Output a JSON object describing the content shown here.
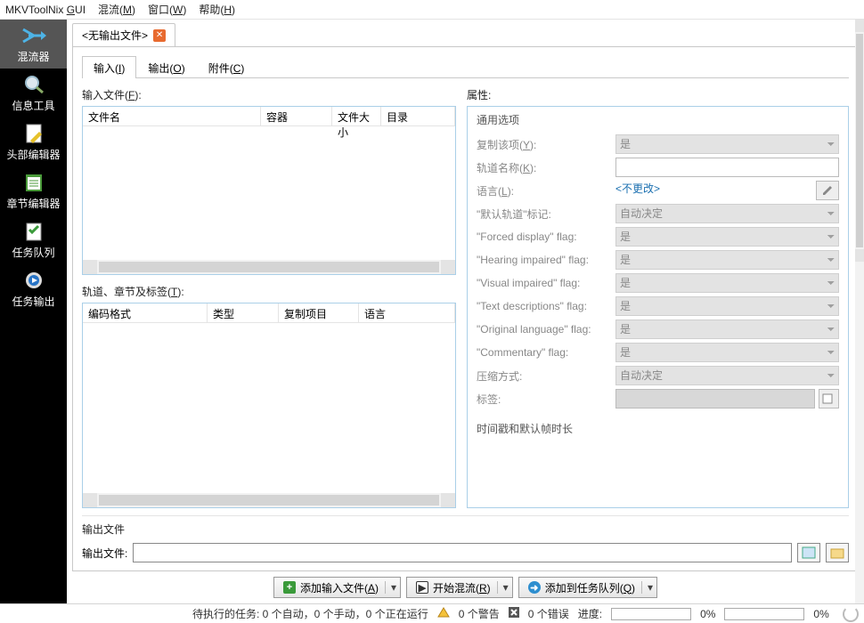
{
  "menu": {
    "app": "MKVToolNix GUI",
    "mux": "混流(M)",
    "window": "窗口(W)",
    "help": "帮助(H)"
  },
  "nav": {
    "items": [
      {
        "label": "混流器"
      },
      {
        "label": "信息工具"
      },
      {
        "label": "头部编辑器"
      },
      {
        "label": "章节编辑器"
      },
      {
        "label": "任务队列"
      },
      {
        "label": "任务输出"
      }
    ]
  },
  "filetab": {
    "label": "<无输出文件>"
  },
  "subtabs": {
    "input": "输入(I)",
    "output": "输出(O)",
    "attachments": "附件(C)"
  },
  "input_files": {
    "label": "输入文件(F):",
    "cols": {
      "name": "文件名",
      "container": "容器",
      "size": "文件大小",
      "dir": "目录"
    }
  },
  "tracks": {
    "label": "轨道、章节及标签(T):",
    "cols": {
      "codec": "编码格式",
      "type": "类型",
      "copy": "复制项目",
      "lang": "语言"
    }
  },
  "props": {
    "header": "属性:",
    "grp_general": "通用选项",
    "copy_track": "复制该项(Y):",
    "track_name": "轨道名称(K):",
    "language": "语言(L):",
    "language_val": "<不更改>",
    "default_flag": "\"默认轨道\"标记:",
    "forced_flag": "\"Forced display\" flag:",
    "hearing_flag": "\"Hearing impaired\" flag:",
    "visual_flag": "\"Visual impaired\" flag:",
    "textdesc_flag": "\"Text descriptions\" flag:",
    "origlang_flag": "\"Original language\" flag:",
    "commentary_flag": "\"Commentary\" flag:",
    "compression": "压缩方式:",
    "tags": "标签:",
    "grp_timing": "时间戳和默认帧时长",
    "val_yes": "是",
    "val_auto": "自动决定"
  },
  "output": {
    "section": "输出文件",
    "label": "输出文件:"
  },
  "actions": {
    "add": "添加输入文件(A)",
    "start": "开始混流(R)",
    "queue": "添加到任务队列(Q)"
  },
  "status": {
    "pending": "待执行的任务: 0 个自动，0 个手动，0 个正在运行",
    "warnings": "0 个警告",
    "errors": "0 个错误",
    "progress": "进度:",
    "pct": "0%"
  }
}
